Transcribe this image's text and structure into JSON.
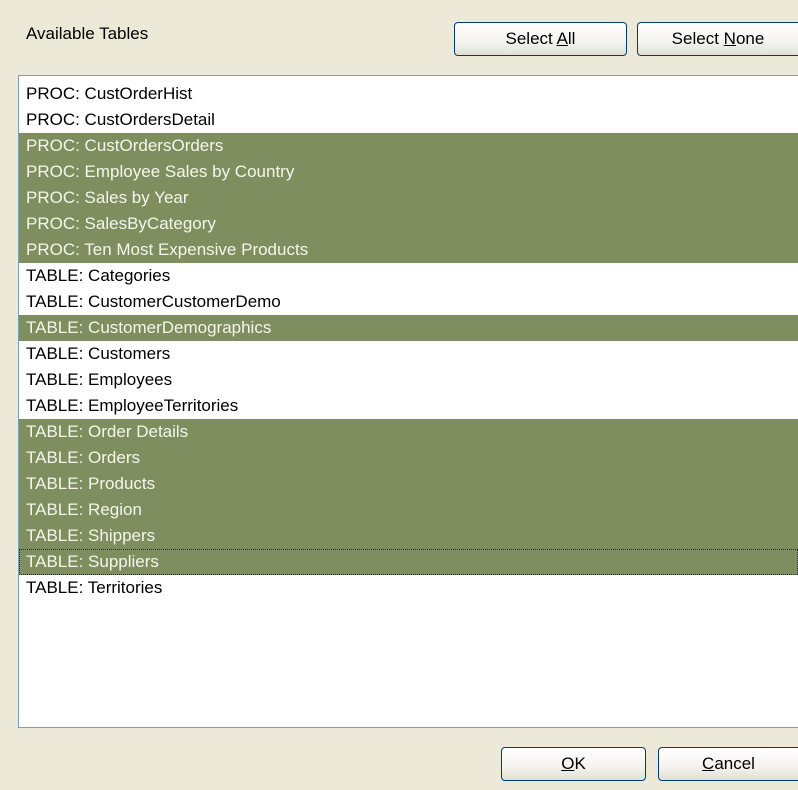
{
  "heading": "Available Tables",
  "buttons": {
    "select_all": {
      "prefix": "Select ",
      "accel": "A",
      "rest": "ll"
    },
    "select_none": {
      "prefix": "Select ",
      "accel": "N",
      "rest": "one"
    },
    "ok": {
      "prefix": "",
      "accel": "O",
      "rest": "K"
    },
    "cancel": {
      "prefix": "",
      "accel": "C",
      "rest": "ancel"
    }
  },
  "colors": {
    "selected_bg": "#7f8e5e",
    "selected_fg": "#f4f6ec",
    "dialog_bg": "#ece9d8"
  },
  "items": [
    {
      "label": "PROC: CustOrderHist",
      "selected": false
    },
    {
      "label": "PROC: CustOrdersDetail",
      "selected": false
    },
    {
      "label": "PROC: CustOrdersOrders",
      "selected": true
    },
    {
      "label": "PROC: Employee Sales by Country",
      "selected": true
    },
    {
      "label": "PROC: Sales by Year",
      "selected": true
    },
    {
      "label": "PROC: SalesByCategory",
      "selected": true
    },
    {
      "label": "PROC: Ten Most Expensive Products",
      "selected": true
    },
    {
      "label": "TABLE: Categories",
      "selected": false
    },
    {
      "label": "TABLE: CustomerCustomerDemo",
      "selected": false
    },
    {
      "label": "TABLE: CustomerDemographics",
      "selected": true
    },
    {
      "label": "TABLE: Customers",
      "selected": false
    },
    {
      "label": "TABLE: Employees",
      "selected": false
    },
    {
      "label": "TABLE: EmployeeTerritories",
      "selected": false
    },
    {
      "label": "TABLE: Order Details",
      "selected": true
    },
    {
      "label": "TABLE: Orders",
      "selected": true
    },
    {
      "label": "TABLE: Products",
      "selected": true
    },
    {
      "label": "TABLE: Region",
      "selected": true
    },
    {
      "label": "TABLE: Shippers",
      "selected": true
    },
    {
      "label": "TABLE: Suppliers",
      "selected": true,
      "focused": true
    },
    {
      "label": "TABLE: Territories",
      "selected": false
    }
  ]
}
